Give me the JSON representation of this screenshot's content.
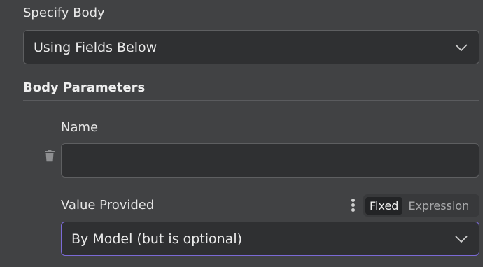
{
  "specify_body": {
    "label": "Specify Body",
    "selected": "Using Fields Below"
  },
  "body_parameters": {
    "title": "Body Parameters",
    "name": {
      "label": "Name",
      "value": ""
    },
    "value_provided": {
      "label": "Value Provided",
      "mode_options": [
        "Fixed",
        "Expression"
      ],
      "active_mode": "Fixed",
      "selected": "By Model (but is optional)"
    }
  },
  "colors": {
    "background": "#414244",
    "input_background": "#2f3032",
    "focus_border": "#7b6ad6"
  },
  "icons": {
    "dropdown": "chevron-down-icon",
    "delete": "trash-icon",
    "options": "kebab-menu-icon"
  }
}
